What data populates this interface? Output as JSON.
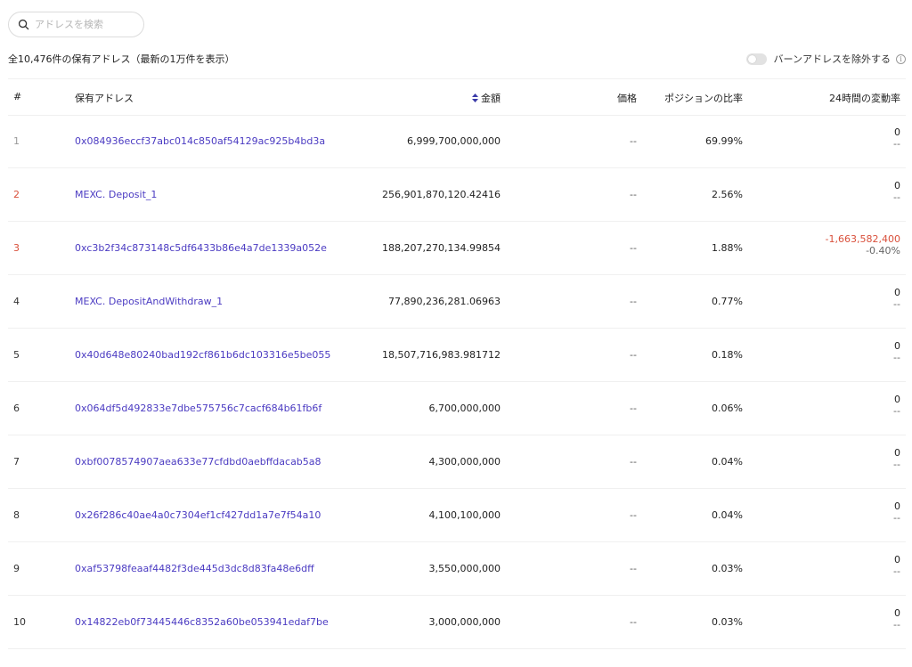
{
  "search": {
    "placeholder": "アドレスを検索"
  },
  "summary": "全10,476件の保有アドレス（最新の1万件を表示）",
  "toggle": {
    "label": "バーンアドレスを除外する",
    "on": false
  },
  "colors": {
    "link": "#4b3bc2",
    "negative": "#d9503b"
  },
  "header": {
    "rank": "#",
    "address": "保有アドレス",
    "amount": "金額",
    "price": "価格",
    "share": "ポジションの比率",
    "change": "24時間の変動率"
  },
  "rows": [
    {
      "rank": "1",
      "address": "0x084936eccf37abc014c850af54129ac925b4bd3a",
      "amount": "6,999,700,000,000",
      "price": "--",
      "share": "69.99%",
      "change": "0",
      "change_pct": "--"
    },
    {
      "rank": "2",
      "address": "MEXC. Deposit_1",
      "amount": "256,901,870,120.42416",
      "price": "--",
      "share": "2.56%",
      "change": "0",
      "change_pct": "--"
    },
    {
      "rank": "3",
      "address": "0xc3b2f34c873148c5df6433b86e4a7de1339a052e",
      "amount": "188,207,270,134.99854",
      "price": "--",
      "share": "1.88%",
      "change": "-1,663,582,400",
      "change_pct": "-0.40%"
    },
    {
      "rank": "4",
      "address": "MEXC. DepositAndWithdraw_1",
      "amount": "77,890,236,281.06963",
      "price": "--",
      "share": "0.77%",
      "change": "0",
      "change_pct": "--"
    },
    {
      "rank": "5",
      "address": "0x40d648e80240bad192cf861b6dc103316e5be055",
      "amount": "18,507,716,983.981712",
      "price": "--",
      "share": "0.18%",
      "change": "0",
      "change_pct": "--"
    },
    {
      "rank": "6",
      "address": "0x064df5d492833e7dbe575756c7cacf684b61fb6f",
      "amount": "6,700,000,000",
      "price": "--",
      "share": "0.06%",
      "change": "0",
      "change_pct": "--"
    },
    {
      "rank": "7",
      "address": "0xbf0078574907aea633e77cfdbd0aebffdacab5a8",
      "amount": "4,300,000,000",
      "price": "--",
      "share": "0.04%",
      "change": "0",
      "change_pct": "--"
    },
    {
      "rank": "8",
      "address": "0x26f286c40ae4a0c7304ef1cf427dd1a7e7f54a10",
      "amount": "4,100,100,000",
      "price": "--",
      "share": "0.04%",
      "change": "0",
      "change_pct": "--"
    },
    {
      "rank": "9",
      "address": "0xaf53798feaaf4482f3de445d3dc8d83fa48e6dff",
      "amount": "3,550,000,000",
      "price": "--",
      "share": "0.03%",
      "change": "0",
      "change_pct": "--"
    },
    {
      "rank": "10",
      "address": "0x14822eb0f73445446c8352a60be053941edaf7be",
      "amount": "3,000,000,000",
      "price": "--",
      "share": "0.03%",
      "change": "0",
      "change_pct": "--"
    }
  ]
}
